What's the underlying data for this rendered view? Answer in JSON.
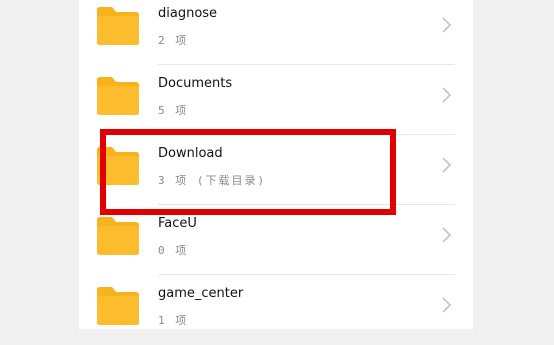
{
  "folders": [
    {
      "name": "diagnose",
      "subtitle": "2 项",
      "icon": "folder-icon"
    },
    {
      "name": "Documents",
      "subtitle": "5 项",
      "icon": "folder-icon"
    },
    {
      "name": "Download",
      "subtitle": "3 项 (下载目录)",
      "icon": "folder-icon"
    },
    {
      "name": "FaceU",
      "subtitle": "0 项",
      "icon": "folder-icon"
    },
    {
      "name": "game_center",
      "subtitle": "1 项",
      "icon": "folder-icon"
    }
  ],
  "colors": {
    "folder": "#fbbd2e",
    "folder_tab": "#f7b21c",
    "highlight": "#e00000"
  },
  "highlighted_folder": "Download"
}
